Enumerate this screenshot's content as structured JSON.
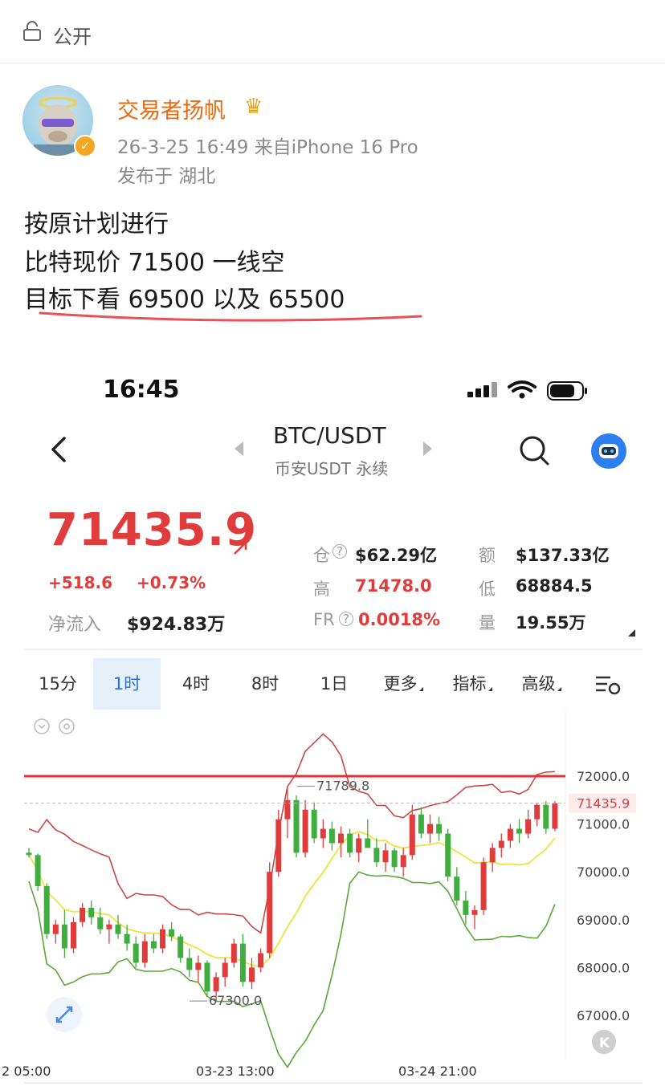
{
  "post": {
    "visibility": "公开",
    "username": "交易者扬帆",
    "timestamp": "26-3-25 16:49",
    "device": "来自iPhone 16 Pro",
    "location": "发布于 湖北",
    "lines": [
      "按原计划进行",
      "比特现价 71500 一线空",
      "目标下看 69500 以及 65500"
    ]
  },
  "screenshot": {
    "status_time": "16:45",
    "pair": "BTC/USDT",
    "exchange": "币安USDT 永续",
    "price": "71435.9",
    "change_abs": "+518.6",
    "change_pct": "+0.73%",
    "net_inflow_label": "净流入",
    "net_inflow_value": "$924.83万",
    "stats": {
      "oi_label": "仓",
      "oi_value": "$62.29亿",
      "amount_label": "额",
      "amount_value": "$137.33亿",
      "high_label": "高",
      "high_value": "71478.0",
      "low_label": "低",
      "low_value": "68884.5",
      "fr_label": "FR",
      "fr_value": "0.0018%",
      "vol_label": "量",
      "vol_value": "19.55万"
    },
    "tabs": [
      "15分",
      "1时",
      "4时",
      "8时",
      "1日",
      "更多",
      "指标",
      "高级"
    ],
    "active_tab": "1时",
    "colors": {
      "up": "#e03c3c",
      "down": "#3fae3f",
      "accent": "#2a6fdb",
      "username": "#e86a12"
    }
  },
  "chart_data": {
    "type": "candlestick",
    "y_ticks": [
      "72000.0",
      "71000.0",
      "70000.0",
      "69000.0",
      "68000.0",
      "67000.0"
    ],
    "x_ticks": [
      "2 05:00",
      "03-23 13:00",
      "03-24 21:00"
    ],
    "current_price_label": "71435.9",
    "current_price": 71435.9,
    "resistance_line": 72000,
    "high_annotation": "71789.8",
    "low_annotation": "67300.0",
    "ylim": [
      66500,
      73000
    ],
    "candles": [
      [
        70400,
        70500,
        70300,
        70350
      ],
      [
        70350,
        70380,
        69600,
        69700
      ],
      [
        69700,
        69760,
        68600,
        68700
      ],
      [
        68700,
        69000,
        68500,
        68900
      ],
      [
        68900,
        69200,
        68200,
        68400
      ],
      [
        68400,
        69050,
        68300,
        68950
      ],
      [
        68950,
        69350,
        68850,
        69250
      ],
      [
        69250,
        69400,
        68900,
        69050
      ],
      [
        69050,
        69250,
        68700,
        68800
      ],
      [
        68800,
        69000,
        68500,
        68900
      ],
      [
        68900,
        69100,
        68600,
        68700
      ],
      [
        68700,
        68900,
        68350,
        68500
      ],
      [
        68500,
        68650,
        68000,
        68100
      ],
      [
        68100,
        68700,
        68000,
        68550
      ],
      [
        68550,
        68700,
        68300,
        68400
      ],
      [
        68400,
        68900,
        68300,
        68800
      ],
      [
        68800,
        68950,
        68550,
        68650
      ],
      [
        68650,
        68700,
        68100,
        68200
      ],
      [
        68200,
        68400,
        67800,
        67950
      ],
      [
        67950,
        68250,
        67700,
        68100
      ],
      [
        68100,
        68150,
        67400,
        67500
      ],
      [
        67500,
        67900,
        67300,
        67800
      ],
      [
        67800,
        68200,
        67600,
        68100
      ],
      [
        68100,
        68600,
        68000,
        68500
      ],
      [
        68500,
        68700,
        67600,
        67700
      ],
      [
        67700,
        68200,
        67550,
        68000
      ],
      [
        68000,
        68400,
        67900,
        68300
      ],
      [
        68300,
        70200,
        68200,
        70000
      ],
      [
        70000,
        71300,
        69900,
        71100
      ],
      [
        71100,
        71790,
        70700,
        71500
      ],
      [
        71500,
        71600,
        70300,
        70400
      ],
      [
        70400,
        71500,
        70300,
        71300
      ],
      [
        71300,
        71450,
        70600,
        70700
      ],
      [
        70700,
        71100,
        70500,
        70900
      ],
      [
        70900,
        71050,
        70450,
        70600
      ],
      [
        70600,
        70950,
        70300,
        70800
      ],
      [
        70800,
        70900,
        70300,
        70400
      ],
      [
        70400,
        70800,
        70200,
        70700
      ],
      [
        70700,
        71100,
        70500,
        70500
      ],
      [
        70500,
        70700,
        70100,
        70200
      ],
      [
        70200,
        70600,
        70000,
        70450
      ],
      [
        70450,
        70500,
        70000,
        70100
      ],
      [
        70100,
        70500,
        69900,
        70350
      ],
      [
        70350,
        71400,
        70250,
        71200
      ],
      [
        71200,
        71350,
        70700,
        70800
      ],
      [
        70800,
        71200,
        70600,
        71000
      ],
      [
        71000,
        71150,
        70650,
        70800
      ],
      [
        70800,
        70900,
        69800,
        69900
      ],
      [
        69900,
        70100,
        69300,
        69400
      ],
      [
        69400,
        69600,
        68900,
        69100
      ],
      [
        69100,
        69300,
        68800,
        69200
      ],
      [
        69200,
        70300,
        69100,
        70200
      ],
      [
        70200,
        70600,
        70000,
        70500
      ],
      [
        70500,
        70800,
        70300,
        70650
      ],
      [
        70650,
        71000,
        70500,
        70900
      ],
      [
        70900,
        71100,
        70600,
        70800
      ],
      [
        70800,
        71300,
        70700,
        71100
      ],
      [
        71100,
        71450,
        70950,
        71400
      ],
      [
        71400,
        71480,
        70800,
        70900
      ],
      [
        70900,
        71478,
        70850,
        71436
      ]
    ]
  }
}
